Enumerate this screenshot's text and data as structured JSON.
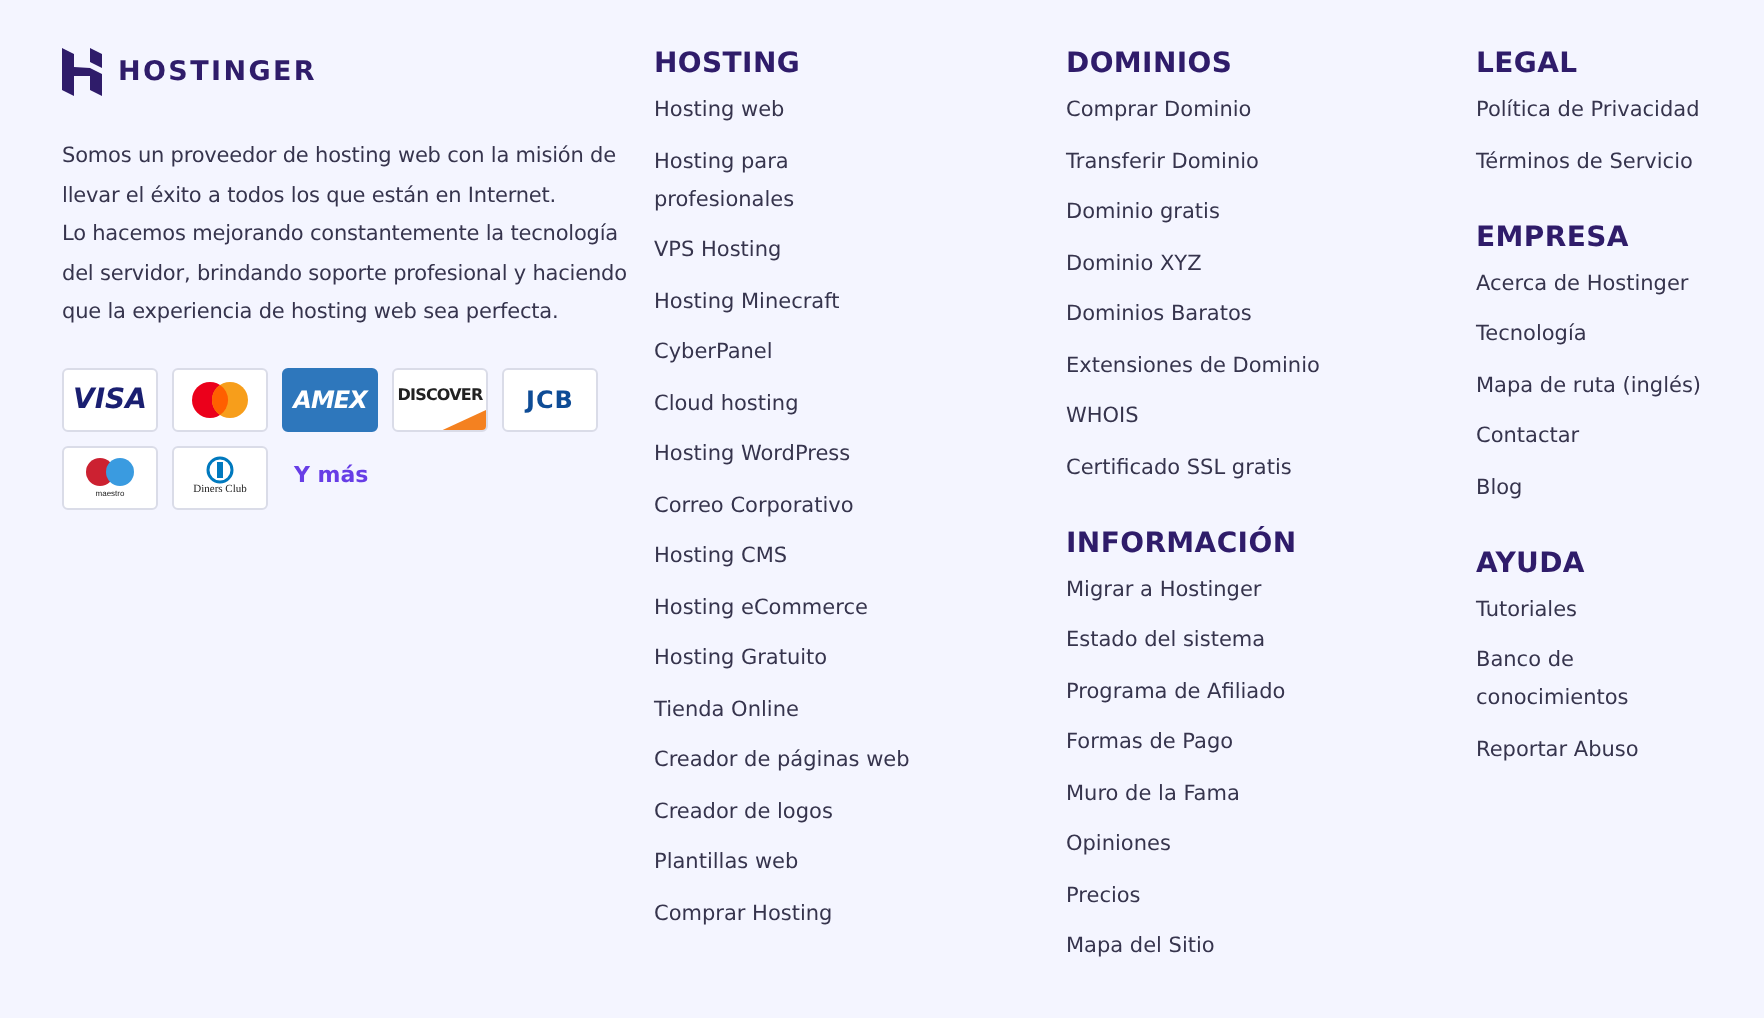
{
  "brand": {
    "name": "HOSTINGER"
  },
  "description": "Somos un proveedor de hosting web con la misión de llevar el éxito a todos los que están en Internet.\nLo hacemos mejorando constantemente la tecnología del servidor, brindando soporte profesional y haciendo que la experiencia de hosting web sea perfecta.",
  "payment_methods": [
    {
      "kind": "visa",
      "label": "VISA"
    },
    {
      "kind": "mastercard"
    },
    {
      "kind": "amex",
      "label": "AMEX"
    },
    {
      "kind": "discover",
      "label": "DISCOVER"
    },
    {
      "kind": "jcb",
      "label": "JCB"
    },
    {
      "kind": "maestro",
      "label": "maestro"
    },
    {
      "kind": "diners",
      "label": "Diners Club"
    }
  ],
  "more_link": "Y más",
  "columns": [
    {
      "sections": [
        {
          "title": "HOSTING",
          "links": [
            "Hosting web",
            "Hosting para profesionales",
            "VPS Hosting",
            "Hosting Minecraft",
            "CyberPanel",
            "Cloud hosting",
            "Hosting WordPress",
            "Correo Corporativo",
            "Hosting CMS",
            "Hosting eCommerce",
            "Hosting Gratuito",
            "Tienda Online",
            "Creador de páginas web",
            "Creador de logos",
            "Plantillas web",
            "Comprar Hosting"
          ]
        }
      ]
    },
    {
      "sections": [
        {
          "title": "DOMINIOS",
          "links": [
            "Comprar Dominio",
            "Transferir Dominio",
            "Dominio gratis",
            "Dominio XYZ",
            "Dominios Baratos",
            "Extensiones de Dominio",
            "WHOIS",
            "Certificado SSL gratis"
          ]
        },
        {
          "title": "INFORMACIÓN",
          "links": [
            "Migrar a Hostinger",
            "Estado del sistema",
            "Programa de Afiliado",
            "Formas de Pago",
            "Muro de la Fama",
            "Opiniones",
            "Precios",
            "Mapa del Sitio"
          ]
        }
      ]
    },
    {
      "sections": [
        {
          "title": "LEGAL",
          "links": [
            "Política de Privacidad",
            "Términos de Servicio"
          ]
        },
        {
          "title": "EMPRESA",
          "links": [
            "Acerca de Hostinger",
            "Tecnología",
            "Mapa de ruta (inglés)",
            "Contactar",
            "Blog"
          ]
        },
        {
          "title": "AYUDA",
          "links": [
            "Tutoriales",
            "Banco de conocimientos",
            "Reportar Abuso"
          ]
        }
      ]
    }
  ]
}
